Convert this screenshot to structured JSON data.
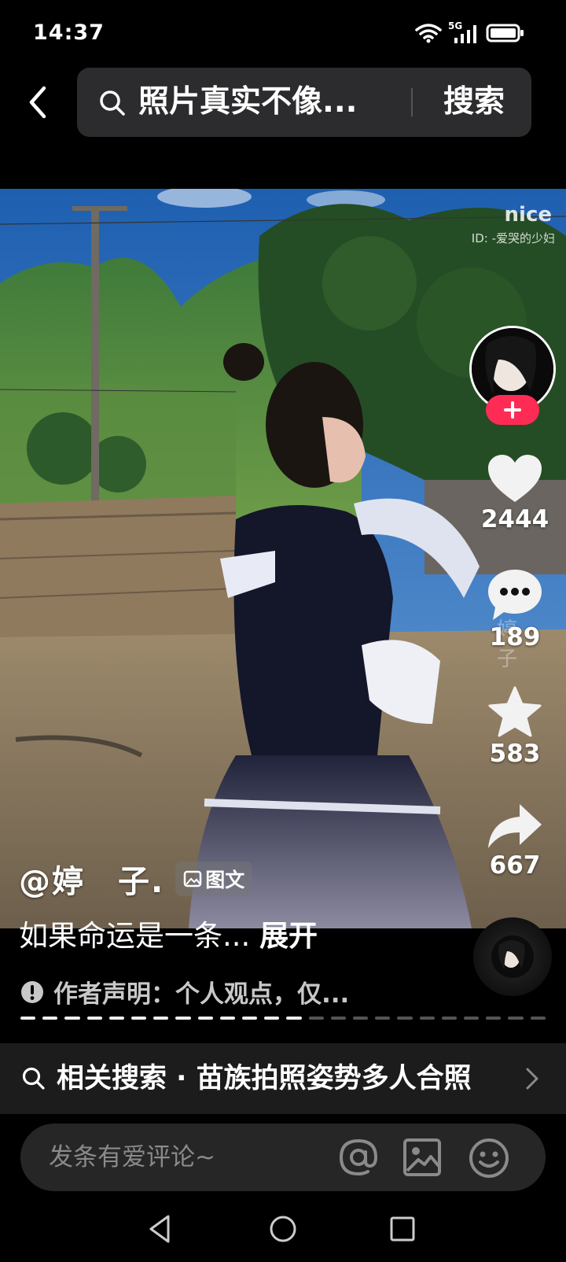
{
  "status_bar": {
    "time": "14:37",
    "network": "5G"
  },
  "search": {
    "query": "照片真实不像...",
    "button_label": "搜索"
  },
  "post": {
    "watermark_title": "nice",
    "watermark_id": "ID: -爱哭的少妇",
    "faded_author": "婷 子",
    "author": "@婷　子.",
    "type_tag": "图文",
    "caption": "如果命运是一条...",
    "expand_label": "展开",
    "disclaimer": "作者声明：个人观点，仅...",
    "progress": {
      "total": 24,
      "current": 13
    }
  },
  "actions": {
    "likes": "2444",
    "comments": "189",
    "favorites": "583",
    "shares": "667"
  },
  "related_search": {
    "label": "相关搜索 · 苗族拍照姿势多人合照"
  },
  "comment_bar": {
    "placeholder": "发条有爱评论~"
  },
  "colors": {
    "accent": "#fe2c55",
    "background": "#000000"
  },
  "icons": [
    "back-icon",
    "search-icon",
    "heart-icon",
    "comment-icon",
    "star-icon",
    "share-icon",
    "warning-icon",
    "at-icon",
    "image-icon",
    "emoji-icon",
    "nav-back-icon",
    "nav-home-icon",
    "nav-recents-icon"
  ]
}
